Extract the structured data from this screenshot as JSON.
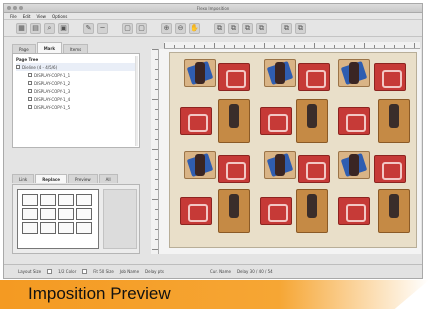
{
  "window": {
    "title": "Flexo Imposition"
  },
  "menu": [
    "File",
    "Edit",
    "View",
    "Options"
  ],
  "toolbar": [
    "grid",
    "grid2",
    "zoom",
    "view",
    "pen",
    "page",
    "page2",
    "zoom-in",
    "zoom-out",
    "hand",
    "copy",
    "copy2",
    "copy3",
    "copy4",
    "copy5",
    "copy6"
  ],
  "left_panel": {
    "tabs_top": [
      "Page",
      "Mark",
      "Items"
    ],
    "tree_header": "Page Tree",
    "tree_items": [
      "Dieline (4 - 4/5/6)",
      "DISPLAY-COPY-1_1",
      "DISPLAY-COPY-1_2",
      "DISPLAY-COPY-1_3",
      "DISPLAY-COPY-1_4",
      "DISPLAY-COPY-1_5"
    ],
    "tabs_mid": [
      "Link",
      "Replace",
      "Preview",
      "All"
    ]
  },
  "statusbar": {
    "items": [
      "Layout Size",
      "1/2 Color",
      "Fit 50 Size",
      "Job Name",
      "Delay pts",
      "Cur. Name",
      "Delay 30 / 40 / 54"
    ]
  },
  "banner": {
    "caption": "Imposition Preview"
  },
  "colors": {
    "banner": "#f49a22",
    "panel_red": "#c63a37",
    "panel_tan": "#d9b486"
  }
}
